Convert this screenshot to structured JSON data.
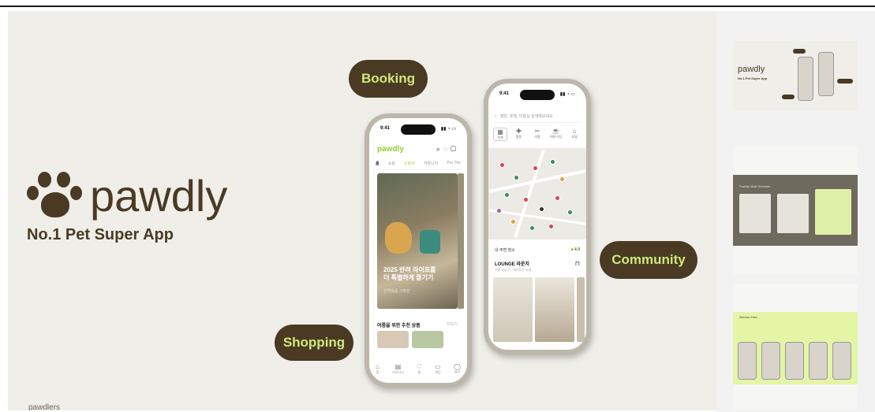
{
  "slide": {
    "brand_name": "pawdly",
    "tagline": "No.1 Pet Super App",
    "footer": "pawdlers",
    "pills": {
      "booking": "Booking",
      "community": "Community",
      "shopping": "Shopping"
    }
  },
  "colors": {
    "slide_bg": "#efeee8",
    "brand_brown": "#4a3a24",
    "pill_text": "#cfe87a",
    "accent_green": "#9ac93a"
  },
  "phone_home": {
    "time": "9:41",
    "logo": "pawdly",
    "header_icons": [
      "search-icon",
      "bell-icon",
      "bag-icon"
    ],
    "tabs": [
      "홈",
      "쇼핑",
      "스토어",
      "커뮤니티",
      "Pro Tier"
    ],
    "hero_title": "2025 반려 라이프를\n더 특별하게 즐기기",
    "hero_sub": "산책용품 기획전",
    "section_title": "여름을 위한 추천 상품",
    "section_more": "더보기",
    "nav": [
      {
        "icon": "home-icon",
        "label": "홈"
      },
      {
        "icon": "community-icon",
        "label": "커뮤니티"
      },
      {
        "icon": "heart-icon",
        "label": "찜"
      },
      {
        "icon": "chat-icon",
        "label": "채팅"
      },
      {
        "icon": "user-icon",
        "label": "마이"
      }
    ]
  },
  "phone_map": {
    "time": "9:41",
    "search_placeholder": "병원, 호텔, 미용실 검색해보세요",
    "categories": [
      "전체",
      "병원",
      "미용",
      "카페·식당",
      "호텔"
    ],
    "list_header": "내 주변 장소",
    "list_badge": "4.9",
    "place_title": "LOUNGE 라운지",
    "place_sub": "서울 강남구 · 애견동반 카페"
  },
  "thumbnails": [
    {
      "label": "pawdly",
      "sublabel": "No.1 Pet Super App"
    },
    {
      "label": "Pawdly Main Services"
    },
    {
      "label": "Service Flow"
    }
  ]
}
